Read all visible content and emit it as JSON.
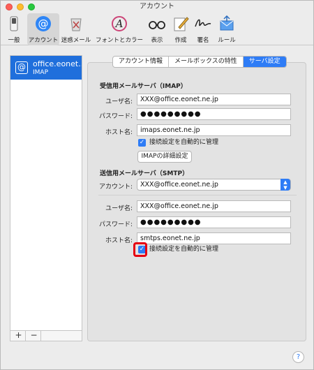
{
  "window": {
    "title": "アカウント"
  },
  "toolbar": {
    "items": [
      {
        "label": "一般",
        "icon": "switch-icon"
      },
      {
        "label": "アカウント",
        "icon": "at-sign-icon",
        "selected": true
      },
      {
        "label": "迷惑メール",
        "icon": "junk-trash-icon"
      },
      {
        "label": "フォントとカラー",
        "icon": "font-color-icon"
      },
      {
        "label": "表示",
        "icon": "glasses-icon"
      },
      {
        "label": "作成",
        "icon": "compose-pencil-icon"
      },
      {
        "label": "署名",
        "icon": "signature-icon"
      },
      {
        "label": "ルール",
        "icon": "rules-envelope-icon"
      }
    ]
  },
  "sidebar": {
    "account": {
      "name": "office.eonet...",
      "type": "IMAP"
    },
    "add_label": "+",
    "remove_label": "−"
  },
  "tabs": [
    {
      "label": "アカウント情報"
    },
    {
      "label": "メールボックスの特性"
    },
    {
      "label": "サーバ設定",
      "active": true
    }
  ],
  "incoming": {
    "heading": "受信用メールサーバ（IMAP）",
    "user_label": "ユーザ名:",
    "user_value": "XXX@office.eonet.ne.jp",
    "password_label": "パスワード:",
    "password_value": "●●●●●●●●●",
    "host_label": "ホスト名:",
    "host_value": "imaps.eonet.ne.jp",
    "auto_label": "接続設定を自動的に管理",
    "advanced_button": "IMAPの詳細設定"
  },
  "outgoing": {
    "heading": "送信用メールサーバ（SMTP）",
    "account_label": "アカウント:",
    "account_value": "XXX@office.eonet.ne.jp",
    "user_label": "ユーザ名:",
    "user_value": "XXX@office.eonet.ne.jp",
    "password_label": "パスワード:",
    "password_value": "●●●●●●●●●",
    "host_label": "ホスト名:",
    "host_value": "smtps.eonet.ne.jp",
    "auto_label": "接続設定を自動的に管理"
  },
  "help": {
    "label": "?"
  },
  "colors": {
    "accent": "#2e7cf6",
    "highlight": "#e60012",
    "selection": "#1f6fdc"
  }
}
